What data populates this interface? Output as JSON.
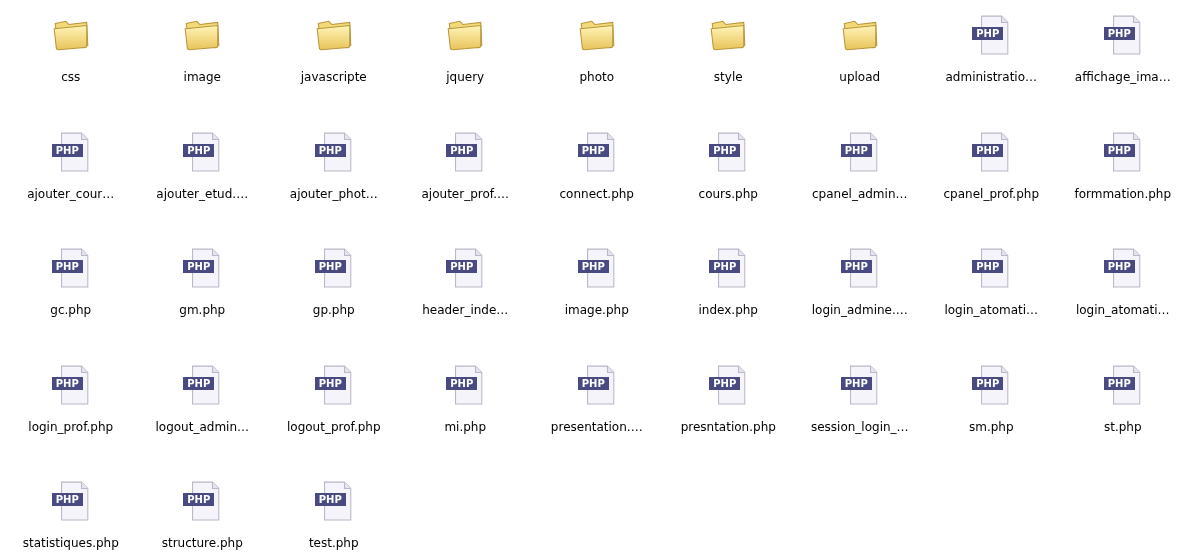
{
  "files": [
    {
      "kind": "folder",
      "name": "css"
    },
    {
      "kind": "folder",
      "name": "image"
    },
    {
      "kind": "folder",
      "name": "javascripte"
    },
    {
      "kind": "folder",
      "name": "jquery"
    },
    {
      "kind": "folder",
      "name": "photo"
    },
    {
      "kind": "folder",
      "name": "style"
    },
    {
      "kind": "folder",
      "name": "upload"
    },
    {
      "kind": "php",
      "badge": "PHP",
      "name": "administratio…"
    },
    {
      "kind": "php",
      "badge": "PHP",
      "name": "affichage_ima…"
    },
    {
      "kind": "php",
      "badge": "PHP",
      "name": "ajouter_cour…"
    },
    {
      "kind": "php",
      "badge": "PHP",
      "name": "ajouter_etud.…"
    },
    {
      "kind": "php",
      "badge": "PHP",
      "name": "ajouter_phot…"
    },
    {
      "kind": "php",
      "badge": "PHP",
      "name": "ajouter_prof.…"
    },
    {
      "kind": "php",
      "badge": "PHP",
      "name": "connect.php"
    },
    {
      "kind": "php",
      "badge": "PHP",
      "name": "cours.php"
    },
    {
      "kind": "php",
      "badge": "PHP",
      "name": "cpanel_admin…"
    },
    {
      "kind": "php",
      "badge": "PHP",
      "name": "cpanel_prof.php"
    },
    {
      "kind": "php",
      "badge": "PHP",
      "name": "formmation.php"
    },
    {
      "kind": "php",
      "badge": "PHP",
      "name": "gc.php"
    },
    {
      "kind": "php",
      "badge": "PHP",
      "name": "gm.php"
    },
    {
      "kind": "php",
      "badge": "PHP",
      "name": "gp.php"
    },
    {
      "kind": "php",
      "badge": "PHP",
      "name": "header_inde…"
    },
    {
      "kind": "php",
      "badge": "PHP",
      "name": "image.php"
    },
    {
      "kind": "php",
      "badge": "PHP",
      "name": "index.php"
    },
    {
      "kind": "php",
      "badge": "PHP",
      "name": "login_admine.…"
    },
    {
      "kind": "php",
      "badge": "PHP",
      "name": "login_atomati…"
    },
    {
      "kind": "php",
      "badge": "PHP",
      "name": "login_atomati…"
    },
    {
      "kind": "php",
      "badge": "PHP",
      "name": "login_prof.php"
    },
    {
      "kind": "php",
      "badge": "PHP",
      "name": "logout_admin…"
    },
    {
      "kind": "php",
      "badge": "PHP",
      "name": "logout_prof.php"
    },
    {
      "kind": "php",
      "badge": "PHP",
      "name": "mi.php"
    },
    {
      "kind": "php",
      "badge": "PHP",
      "name": "presentation.…"
    },
    {
      "kind": "php",
      "badge": "PHP",
      "name": "presntation.php"
    },
    {
      "kind": "php",
      "badge": "PHP",
      "name": "session_login_…"
    },
    {
      "kind": "php",
      "badge": "PHP",
      "name": "sm.php"
    },
    {
      "kind": "php",
      "badge": "PHP",
      "name": "st.php"
    },
    {
      "kind": "php",
      "badge": "PHP",
      "name": "statistiques.php"
    },
    {
      "kind": "php",
      "badge": "PHP",
      "name": "structure.php"
    },
    {
      "kind": "php",
      "badge": "PHP",
      "name": "test.php"
    }
  ]
}
